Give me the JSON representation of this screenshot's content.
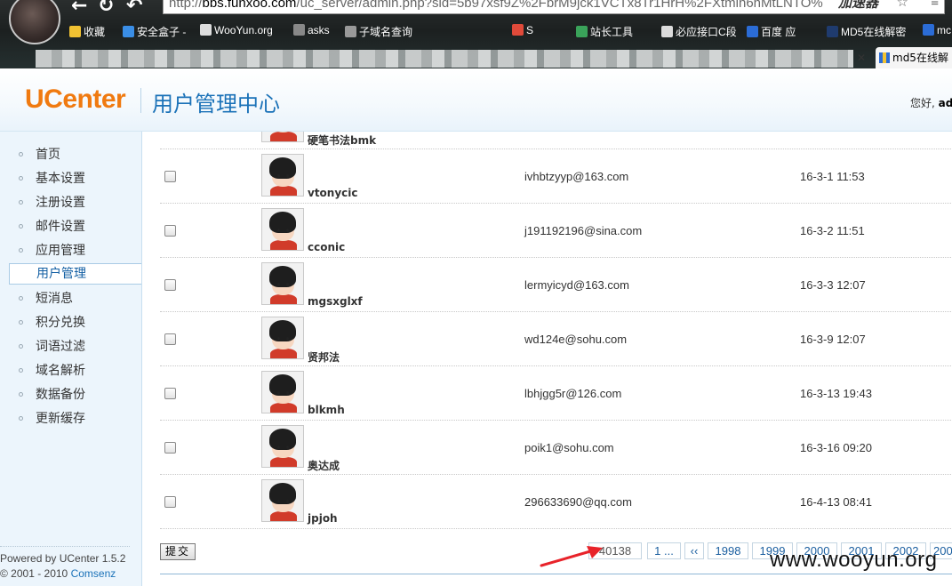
{
  "browser": {
    "url_host": "bbs.funxoo.com",
    "url_path": "/uc_server/admin.php?sid=5b97xsf9Z%2FbrM9jck1VCTx8Tr1HrH%2FXtmlh6hMtLNTO%",
    "accelerator": "加速器",
    "bookmarks": [
      "收藏",
      "安全盒子 -",
      "WooYun.org",
      "asks",
      "子域名查询",
      "S",
      "站长工具",
      "必应接口C段",
      "百度 应",
      "MD5在线解密",
      "mc"
    ],
    "active_tab": "md5在线解"
  },
  "header": {
    "logo": "UCenter",
    "title": "用户管理中心",
    "greeting": "您好,",
    "username": "ad"
  },
  "sidebar": {
    "items": [
      {
        "label": "首页"
      },
      {
        "label": "基本设置"
      },
      {
        "label": "注册设置"
      },
      {
        "label": "邮件设置"
      },
      {
        "label": "应用管理"
      },
      {
        "label": "用户管理",
        "active": true
      },
      {
        "label": "短消息"
      },
      {
        "label": "积分兑换"
      },
      {
        "label": "词语过滤"
      },
      {
        "label": "域名解析"
      },
      {
        "label": "数据备份"
      },
      {
        "label": "更新缓存"
      }
    ],
    "footer_powered": "Powered by UCenter 1.5.2",
    "footer_copyright": "© 2001 - 2010",
    "footer_link": "Comsenz"
  },
  "users": {
    "partial_user": "硬笔书法bmk",
    "rows": [
      {
        "username": "vtonycic",
        "email": "ivhbtzyyp@163.com",
        "date": "16-3-1 11:53"
      },
      {
        "username": "cconic",
        "email": "j191192196@sina.com",
        "date": "16-3-2 11:51"
      },
      {
        "username": "mgsxglxf",
        "email": "lermyicyd@163.com",
        "date": "16-3-3 12:07"
      },
      {
        "username": "贤邦法",
        "email": "wd124e@sohu.com",
        "date": "16-3-9 12:07"
      },
      {
        "username": "blkmh",
        "email": "lbhjgg5r@126.com",
        "date": "16-3-13 19:43"
      },
      {
        "username": "奥达成",
        "email": "poik1@sohu.com",
        "date": "16-3-16 09:20"
      },
      {
        "username": "jpjoh",
        "email": "296633690@qq.com",
        "date": "16-4-13 08:41"
      }
    ]
  },
  "actions": {
    "submit": "提交"
  },
  "pagination": {
    "total": "40138",
    "first": "1 ...",
    "prev": "‹‹",
    "pages": [
      "1998",
      "1999",
      "2000",
      "2001",
      "2002",
      "200"
    ]
  },
  "watermark": "www.wooyun.org",
  "colors": {
    "logo": "#f07a10",
    "title": "#1b72b8",
    "annotation_arrow": "#e8232a"
  }
}
